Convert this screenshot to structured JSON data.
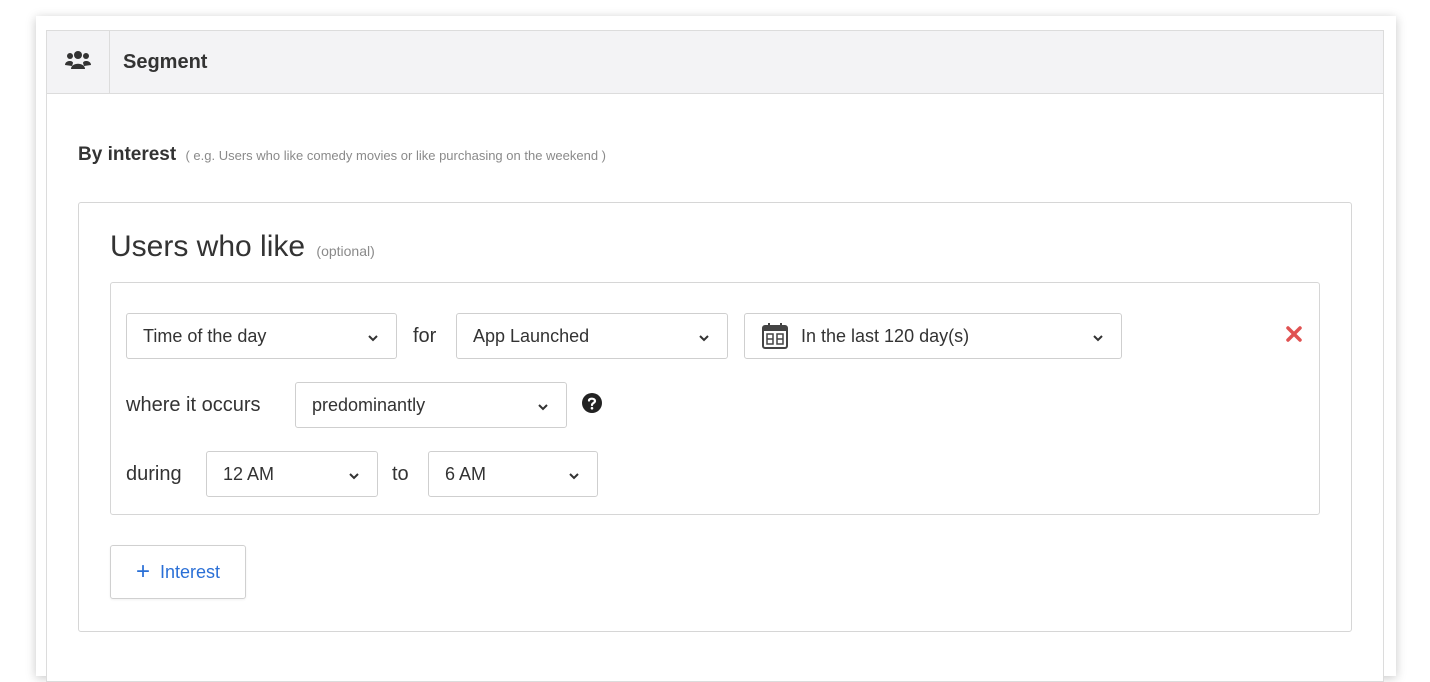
{
  "header": {
    "title": "Segment",
    "icon": "users-icon"
  },
  "by_interest": {
    "label": "By interest",
    "hint": "( e.g. Users who like comedy movies or like purchasing on the weekend )"
  },
  "users_who_like": {
    "title": "Users who like",
    "optional": "(optional)"
  },
  "rule": {
    "attribute_select": "Time of the day",
    "for_word": "for",
    "event_select": "App Launched",
    "date_range_select": "In the last 120 day(s)",
    "where_word": "where it occurs",
    "frequency_select": "predominantly",
    "during_word": "during",
    "from_time_select": "12 AM",
    "to_word": "to",
    "to_time_select": "6 AM"
  },
  "actions": {
    "add_interest_plus": "+",
    "add_interest_label": "Interest"
  },
  "colors": {
    "accent_blue": "#2a6fd6",
    "remove_red": "#e05252",
    "header_bg": "#f3f3f5"
  }
}
